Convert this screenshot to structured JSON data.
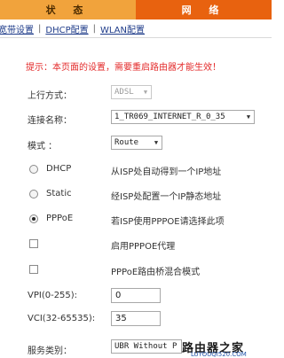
{
  "top_tabs": [
    {
      "label": "状 态"
    },
    {
      "label": "网 络"
    }
  ],
  "subnav": {
    "items": [
      "宽带设置",
      "DHCP配置",
      "WLAN配置"
    ]
  },
  "notice": "提示：本页面的设置，需要重启路由器才能生效！",
  "uplink": {
    "label": "上行方式：",
    "value": "ADSL"
  },
  "connection": {
    "label": "连接名称：",
    "value": "1_TR069_INTERNET_R_0_35"
  },
  "mode": {
    "label": "模式 ：",
    "value": "Route"
  },
  "options": [
    {
      "label": "DHCP",
      "desc": "从ISP处自动得到一个IP地址",
      "checked": false
    },
    {
      "label": "Static",
      "desc": "经ISP处配置一个IP静态地址",
      "checked": false
    },
    {
      "label": "PPPoE",
      "desc": "若ISP使用PPPOE请选择此项",
      "checked": true
    }
  ],
  "checkboxes": [
    {
      "label": "启用PPPOE代理",
      "checked": false
    },
    {
      "label": "PPPoE路由桥混合模式",
      "checked": false
    }
  ],
  "vpi": {
    "label": "VPI(0-255):",
    "value": "0"
  },
  "vci": {
    "label": "VCI(32-65535):",
    "value": "35"
  },
  "service": {
    "label": "服务类别：",
    "value": "UBR Without P"
  },
  "watermark": {
    "title": "路由器之家",
    "url": "LUYOUQI520.COM"
  }
}
